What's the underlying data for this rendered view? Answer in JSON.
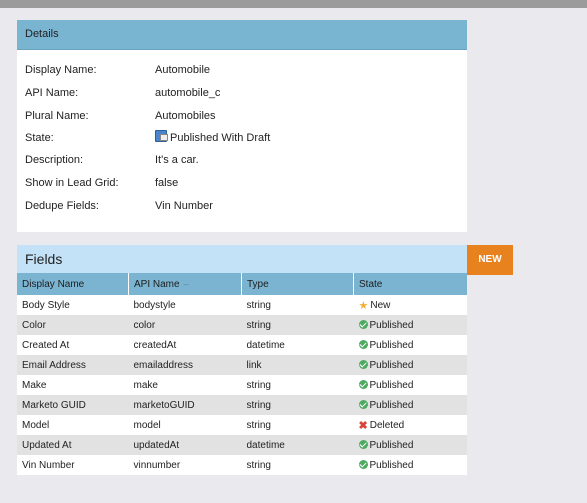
{
  "details": {
    "title": "Details",
    "rows": [
      {
        "label": "Display Name:",
        "value": "Automobile"
      },
      {
        "label": "API Name:",
        "value": "automobile_c"
      },
      {
        "label": "Plural Name:",
        "value": "Automobiles"
      },
      {
        "label": "State:",
        "value": "Published With Draft",
        "icon": "published-with-draft-icon"
      },
      {
        "label": "Description:",
        "value": "It's a car."
      },
      {
        "label": "Show in Lead Grid:",
        "value": "false"
      },
      {
        "label": "Dedupe Fields:",
        "value": "Vin Number"
      }
    ]
  },
  "fields": {
    "title": "Fields",
    "new_button": "NEW",
    "columns": [
      "Display Name",
      "API Name",
      "Type",
      "State"
    ],
    "sort_indicator": "–",
    "rows": [
      {
        "display_name": "Body Style",
        "api_name": "bodystyle",
        "type": "string",
        "state": "New",
        "state_icon": "star-icon"
      },
      {
        "display_name": "Color",
        "api_name": "color",
        "type": "string",
        "state": "Published",
        "state_icon": "check-circle-icon"
      },
      {
        "display_name": "Created At",
        "api_name": "createdAt",
        "type": "datetime",
        "state": "Published",
        "state_icon": "check-circle-icon"
      },
      {
        "display_name": "Email Address",
        "api_name": "emailaddress",
        "type": "link",
        "state": "Published",
        "state_icon": "check-circle-icon"
      },
      {
        "display_name": "Make",
        "api_name": "make",
        "type": "string",
        "state": "Published",
        "state_icon": "check-circle-icon"
      },
      {
        "display_name": "Marketo GUID",
        "api_name": "marketoGUID",
        "type": "string",
        "state": "Published",
        "state_icon": "check-circle-icon"
      },
      {
        "display_name": "Model",
        "api_name": "model",
        "type": "string",
        "state": "Deleted",
        "state_icon": "x-icon"
      },
      {
        "display_name": "Updated At",
        "api_name": "updatedAt",
        "type": "datetime",
        "state": "Published",
        "state_icon": "check-circle-icon"
      },
      {
        "display_name": "Vin Number",
        "api_name": "vinnumber",
        "type": "string",
        "state": "Published",
        "state_icon": "check-circle-icon"
      }
    ]
  },
  "colors": {
    "header_blue": "#79b4d1",
    "fields_header": "#c3e2f7",
    "new_button": "#e8821f",
    "published_green": "#4caa61",
    "deleted_red": "#d8443b",
    "new_star": "#f2b036"
  }
}
